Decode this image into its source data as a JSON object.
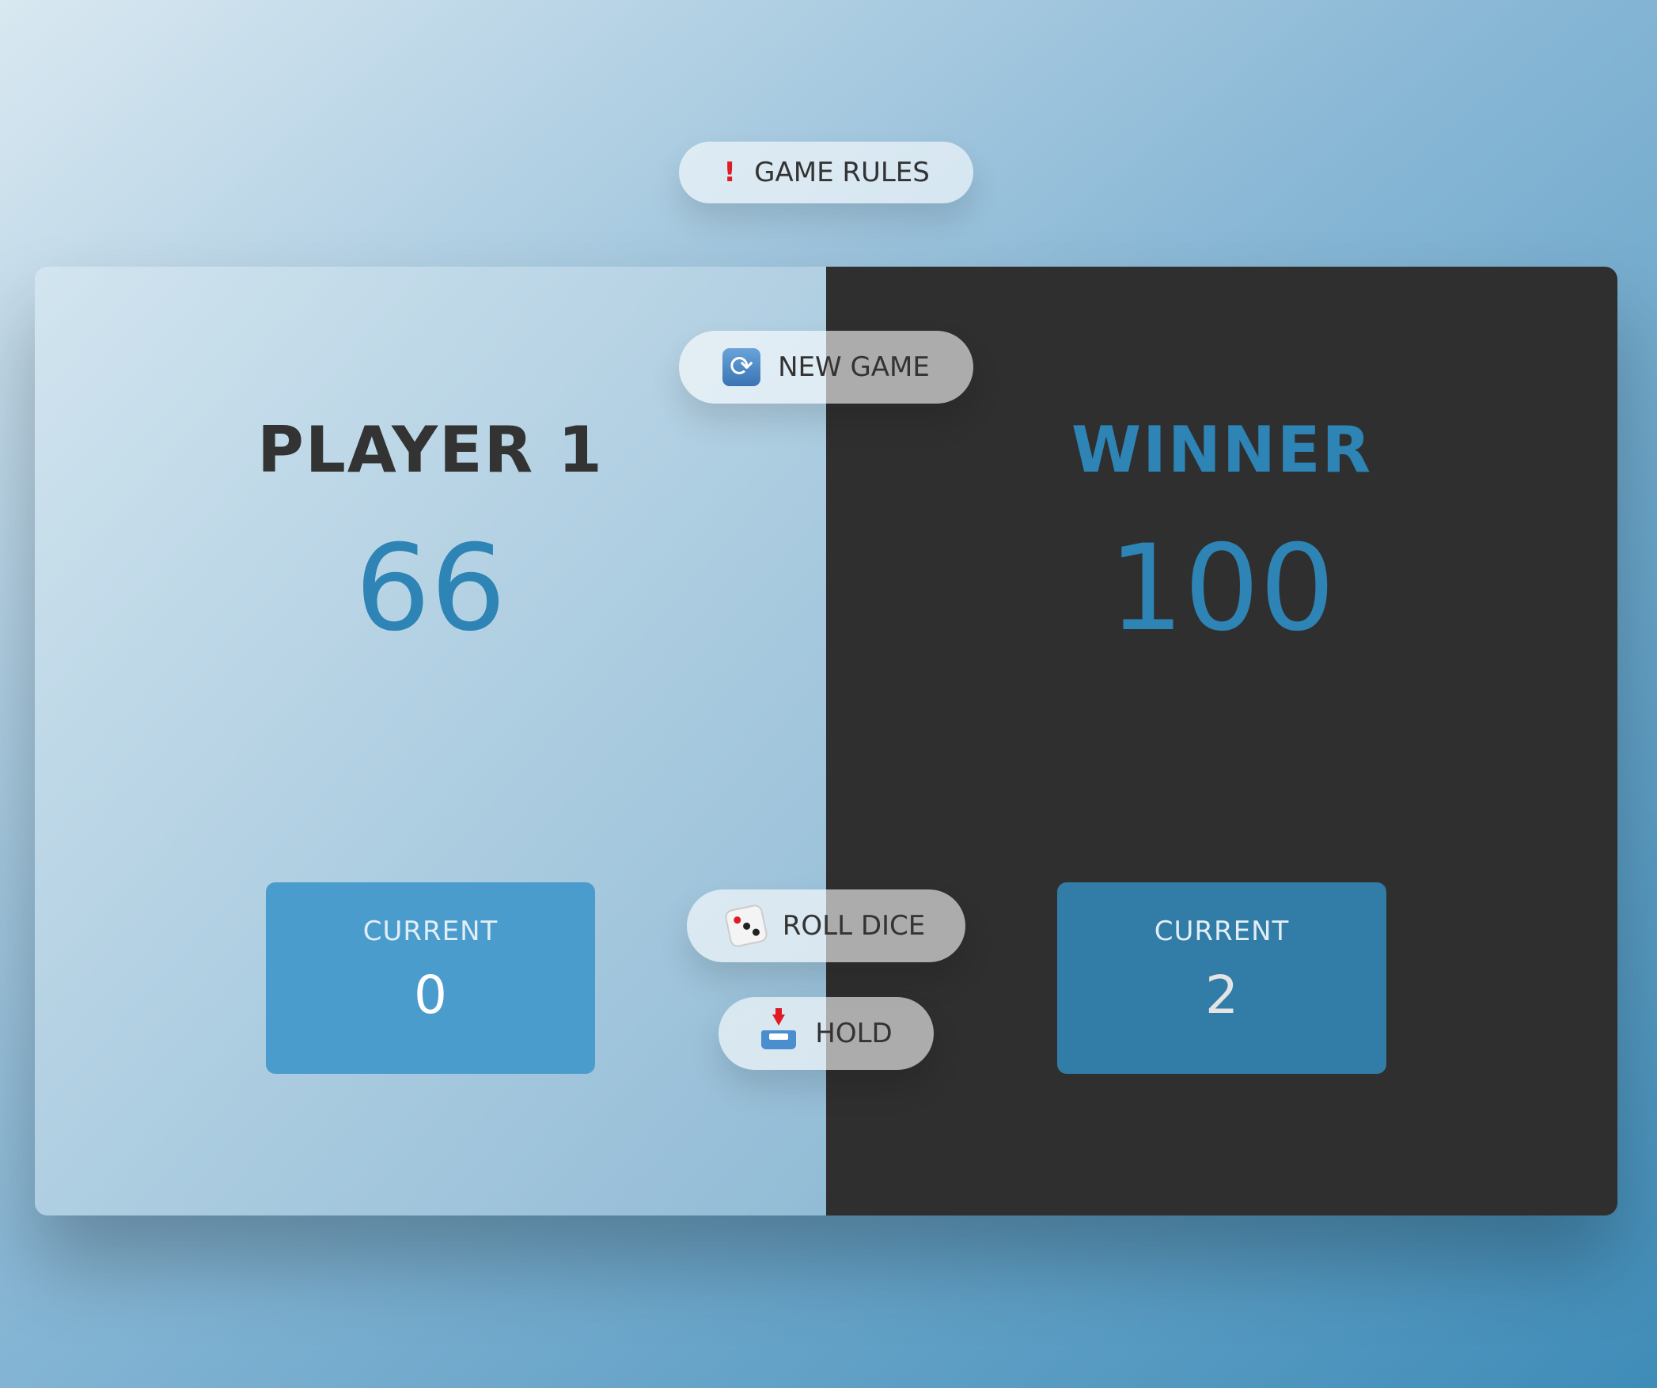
{
  "buttons": {
    "rules": {
      "label": "GAME RULES",
      "icon": "exclamation-icon"
    },
    "new_game": {
      "label": "NEW GAME",
      "icon": "refresh-icon"
    },
    "roll_dice": {
      "label": "ROLL DICE",
      "icon": "dice-icon"
    },
    "hold": {
      "label": "HOLD",
      "icon": "inbox-tray-icon"
    }
  },
  "players": [
    {
      "name": "PLAYER 1",
      "score": "66",
      "current_label": "CURRENT",
      "current_score": "0"
    },
    {
      "name": "WINNER",
      "score": "100",
      "current_label": "CURRENT",
      "current_score": "2"
    }
  ],
  "colors": {
    "accent": "#2d84b5",
    "winner_panel": "#2f2f2f",
    "current_box_active": "#4a9ccd",
    "current_box_winner": "#327ca8"
  }
}
